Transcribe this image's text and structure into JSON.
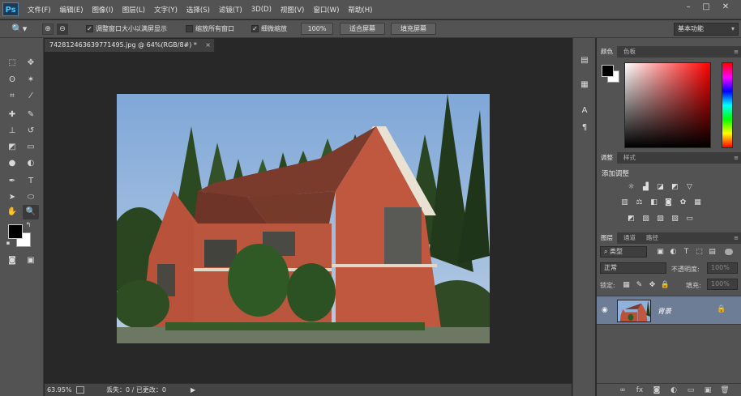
{
  "app": {
    "logo": "Ps",
    "menus": [
      "文件(F)",
      "编辑(E)",
      "图像(I)",
      "图层(L)",
      "文字(Y)",
      "选择(S)",
      "滤镜(T)",
      "3D(D)",
      "视图(V)",
      "窗口(W)",
      "帮助(H)"
    ],
    "window_controls": [
      "minimize-icon",
      "maximize-icon",
      "close-icon"
    ]
  },
  "options": {
    "tool_icon": "zoom-icon",
    "resize_windows_label": "调整窗口大小以满屏显示",
    "resize_windows_checked": true,
    "zoom_all_label": "缩放所有窗口",
    "zoom_all_checked": false,
    "scrubby_label": "细微缩放",
    "scrubby_checked": true,
    "percent_button": "100%",
    "fit_screen_button": "适合屏幕",
    "fill_screen_button": "填充屏幕",
    "workspace": "基本功能"
  },
  "document": {
    "tab_title": "7428124636397714​95.jpg @ 64%(RGB/8#) *",
    "tab_close": "×"
  },
  "status": {
    "zoom": "63.95%",
    "info": "丢失：0 / 已更改：0",
    "arrow": "▶"
  },
  "panels": {
    "color_tabs": [
      "颜色",
      "色板"
    ],
    "adjust_tabs": [
      "调整",
      "样式"
    ],
    "adjust_title": "添加调整",
    "layers_tabs": [
      "图层",
      "通道",
      "路径"
    ],
    "filter_kind": "类型",
    "blend_mode": "正常",
    "opacity_label": "不透明度:",
    "opacity_value": "100%",
    "lock_label": "锁定:",
    "fill_label": "填充:",
    "fill_value": "100%",
    "layer_name": "背景"
  },
  "colors": {
    "foreground": "#000000",
    "background": "#ffffff",
    "selected_layer": "#6e7d96"
  }
}
